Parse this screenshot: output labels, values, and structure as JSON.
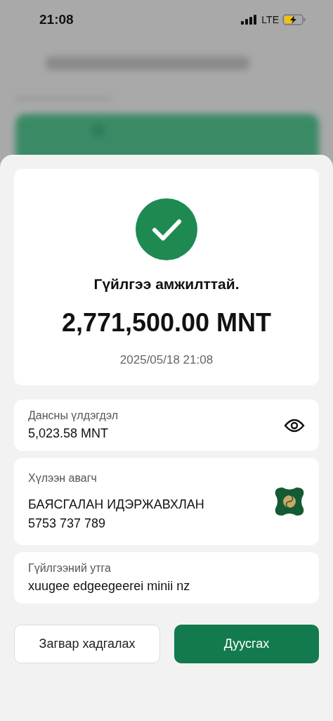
{
  "status_bar": {
    "time": "21:08",
    "network": "LTE"
  },
  "result": {
    "title": "Гүйлгээ амжилттай.",
    "amount": "2,771,500.00 MNT",
    "datetime": "2025/05/18 21:08"
  },
  "details": [
    {
      "kind": "balance",
      "label": "Дансны үлдэгдэл",
      "lines": [
        "5,023.58 MNT"
      ]
    },
    {
      "kind": "recipient",
      "label": "Хүлээн авагч",
      "lines": [
        "БАЯСГАЛАН ИДЭРЖАВХЛАН",
        "5753 737 789"
      ]
    },
    {
      "kind": "plain",
      "label": "Гүйлгээний утга",
      "lines": [
        "xuugee edgeegeerei minii nz"
      ]
    }
  ],
  "buttons": [
    {
      "label": "Загвар хадгалах",
      "kind": "secondary"
    },
    {
      "label": "Дуусгах",
      "kind": "primary"
    }
  ]
}
